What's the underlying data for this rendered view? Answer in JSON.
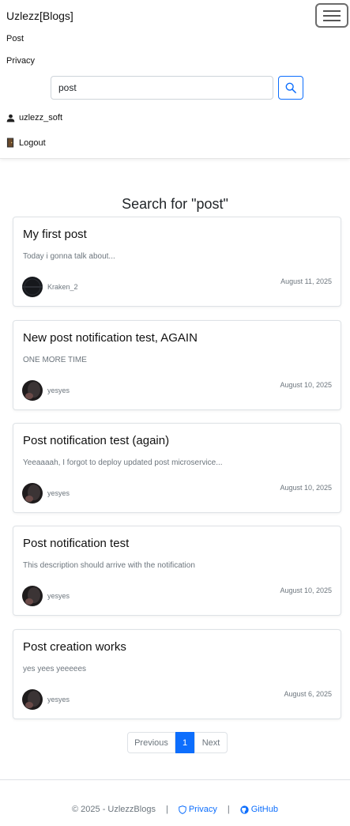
{
  "navbar": {
    "brand": "Uzlezz[Blogs]",
    "links": [
      "Post",
      "Privacy"
    ],
    "search": {
      "value": "post",
      "placeholder": ""
    },
    "user": "uzlezz_soft",
    "logout": "Logout"
  },
  "main": {
    "heading": "Search for \"post\"",
    "posts": [
      {
        "title": "My first post",
        "description": "Today i gonna talk about...",
        "author": "Kraken_2",
        "date": "August 11, 2025"
      },
      {
        "title": "New post notification test, AGAIN",
        "description": "ONE MORE TIME",
        "author": "yesyes",
        "date": "August 10, 2025"
      },
      {
        "title": "Post notification test (again)",
        "description": "Yeeaaaah, I forgot to deploy updated post microservice...",
        "author": "yesyes",
        "date": "August 10, 2025"
      },
      {
        "title": "Post notification test",
        "description": "This description should arrive with the notification",
        "author": "yesyes",
        "date": "August 10, 2025"
      },
      {
        "title": "Post creation works",
        "description": "yes yees yeeeees",
        "author": "yesyes",
        "date": "August 6, 2025"
      }
    ],
    "pagination": {
      "previous": "Previous",
      "current": "1",
      "next": "Next"
    }
  },
  "footer": {
    "copyright": "© 2025 - UzlezzBlogs",
    "separator": "|",
    "privacy": "Privacy",
    "github": "GitHub"
  },
  "colors": {
    "primary": "#0d6efd",
    "muted": "#6c757d"
  }
}
